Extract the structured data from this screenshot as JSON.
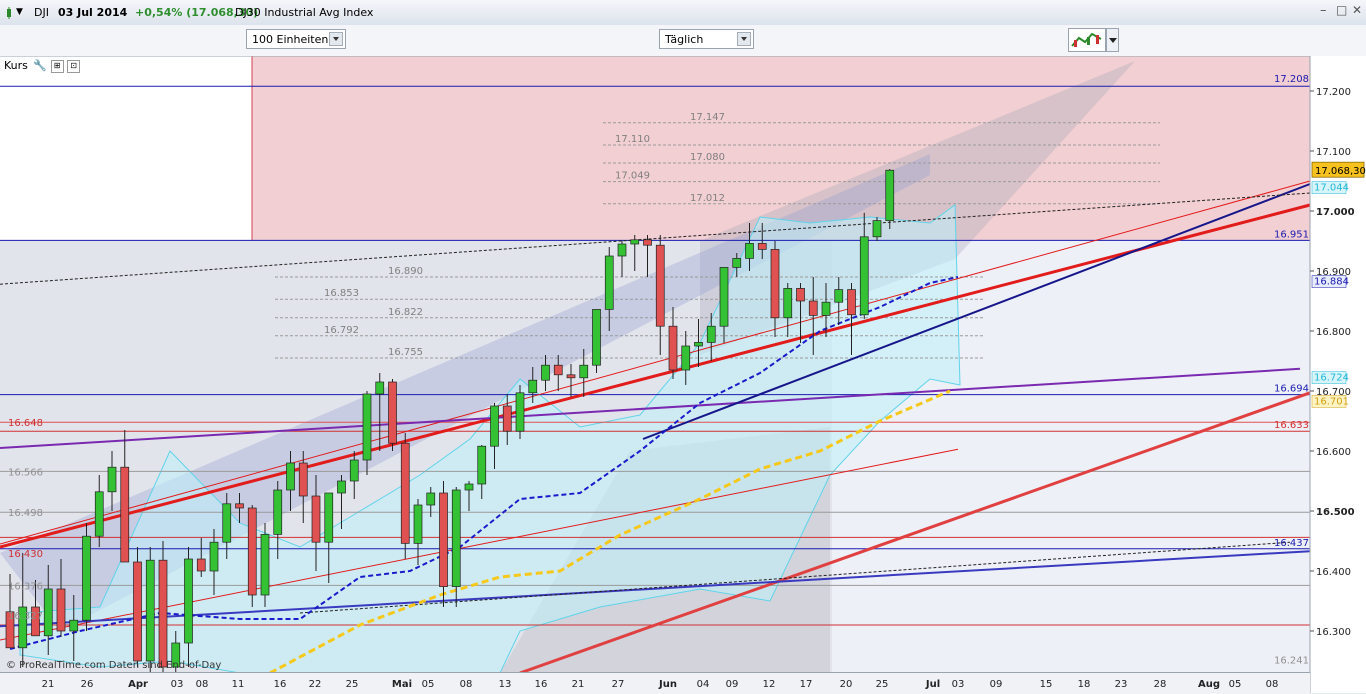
{
  "header": {
    "symbol": "DJI",
    "date": "03 Jul 2014",
    "change": "+0,54% (17.068,30)",
    "name": "DJ30 Industrial Avg Index"
  },
  "toolbar": {
    "units_select": "100 Einheiten",
    "period_select": "Täglich"
  },
  "panel": {
    "label": "Kurs"
  },
  "footer": {
    "copyright": "© ProRealTime.com Daten sind End-of-Day"
  },
  "chart_data": {
    "type": "candlestick",
    "ylim": [
      16230,
      17320
    ],
    "y_ticks": [
      "17.200",
      "17.100",
      "17.000",
      "16.900",
      "16.800",
      "16.700",
      "16.600",
      "16.500",
      "16.400",
      "16.300"
    ],
    "x_tick_labels": [
      "21",
      "26",
      "Apr",
      "03",
      "08",
      "11",
      "16",
      "22",
      "25",
      "Mai",
      "05",
      "08",
      "13",
      "16",
      "21",
      "27",
      "Jun",
      "04",
      "09",
      "12",
      "17",
      "20",
      "25",
      "Jul",
      "03",
      "09",
      "15",
      "18",
      "23",
      "28",
      "Aug",
      "05",
      "08"
    ],
    "last_price": "17.068,30",
    "right_labels": [
      "17.208",
      "17.044",
      "16.951",
      "16.884",
      "16.724",
      "16.694",
      "16.701",
      "16.633",
      "16.437",
      "16.241"
    ],
    "left_labels": [
      "16.648",
      "16.566",
      "16.498",
      "16.430",
      "16.376",
      "16.327"
    ],
    "fib_labels": [
      "17.147",
      "17.110",
      "17.080",
      "17.049",
      "17.012",
      "16.890",
      "16.853",
      "16.822",
      "16.792",
      "16.755"
    ],
    "candles": [
      {
        "o": 16332,
        "h": 16395,
        "l": 16290,
        "c": 16272
      },
      {
        "o": 16272,
        "h": 16430,
        "l": 16240,
        "c": 16340
      },
      {
        "o": 16340,
        "h": 16385,
        "l": 16300,
        "c": 16292
      },
      {
        "o": 16292,
        "h": 16410,
        "l": 16260,
        "c": 16370
      },
      {
        "o": 16370,
        "h": 16420,
        "l": 16290,
        "c": 16300
      },
      {
        "o": 16300,
        "h": 16360,
        "l": 16250,
        "c": 16318
      },
      {
        "o": 16318,
        "h": 16480,
        "l": 16300,
        "c": 16458
      },
      {
        "o": 16458,
        "h": 16560,
        "l": 16440,
        "c": 16532
      },
      {
        "o": 16532,
        "h": 16600,
        "l": 16500,
        "c": 16573
      },
      {
        "o": 16573,
        "h": 16635,
        "l": 16540,
        "c": 16415
      },
      {
        "o": 16415,
        "h": 16440,
        "l": 16240,
        "c": 16250
      },
      {
        "o": 16250,
        "h": 16440,
        "l": 16210,
        "c": 16418
      },
      {
        "o": 16418,
        "h": 16450,
        "l": 16220,
        "c": 16240
      },
      {
        "o": 16240,
        "h": 16300,
        "l": 16190,
        "c": 16280
      },
      {
        "o": 16280,
        "h": 16440,
        "l": 16240,
        "c": 16420
      },
      {
        "o": 16420,
        "h": 16455,
        "l": 16390,
        "c": 16400
      },
      {
        "o": 16400,
        "h": 16470,
        "l": 16360,
        "c": 16448
      },
      {
        "o": 16448,
        "h": 16530,
        "l": 16420,
        "c": 16512
      },
      {
        "o": 16512,
        "h": 16530,
        "l": 16480,
        "c": 16505
      },
      {
        "o": 16505,
        "h": 16510,
        "l": 16340,
        "c": 16360
      },
      {
        "o": 16360,
        "h": 16480,
        "l": 16340,
        "c": 16461
      },
      {
        "o": 16461,
        "h": 16550,
        "l": 16420,
        "c": 16535
      },
      {
        "o": 16535,
        "h": 16600,
        "l": 16500,
        "c": 16580
      },
      {
        "o": 16580,
        "h": 16600,
        "l": 16480,
        "c": 16525
      },
      {
        "o": 16525,
        "h": 16560,
        "l": 16400,
        "c": 16448
      },
      {
        "o": 16448,
        "h": 16530,
        "l": 16380,
        "c": 16530
      },
      {
        "o": 16530,
        "h": 16560,
        "l": 16470,
        "c": 16550
      },
      {
        "o": 16550,
        "h": 16600,
        "l": 16520,
        "c": 16585
      },
      {
        "o": 16585,
        "h": 16700,
        "l": 16560,
        "c": 16695
      },
      {
        "o": 16695,
        "h": 16730,
        "l": 16600,
        "c": 16715
      },
      {
        "o": 16715,
        "h": 16720,
        "l": 16600,
        "c": 16613
      },
      {
        "o": 16613,
        "h": 16630,
        "l": 16420,
        "c": 16446
      },
      {
        "o": 16446,
        "h": 16520,
        "l": 16410,
        "c": 16510
      },
      {
        "o": 16510,
        "h": 16540,
        "l": 16490,
        "c": 16530
      },
      {
        "o": 16530,
        "h": 16550,
        "l": 16340,
        "c": 16374
      },
      {
        "o": 16374,
        "h": 16540,
        "l": 16340,
        "c": 16535
      },
      {
        "o": 16535,
        "h": 16550,
        "l": 16500,
        "c": 16545
      },
      {
        "o": 16545,
        "h": 16610,
        "l": 16520,
        "c": 16608
      },
      {
        "o": 16608,
        "h": 16680,
        "l": 16570,
        "c": 16675
      },
      {
        "o": 16675,
        "h": 16695,
        "l": 16610,
        "c": 16633
      },
      {
        "o": 16633,
        "h": 16710,
        "l": 16620,
        "c": 16697
      },
      {
        "o": 16697,
        "h": 16740,
        "l": 16680,
        "c": 16718
      },
      {
        "o": 16718,
        "h": 16760,
        "l": 16700,
        "c": 16743
      },
      {
        "o": 16743,
        "h": 16760,
        "l": 16700,
        "c": 16727
      },
      {
        "o": 16727,
        "h": 16745,
        "l": 16690,
        "c": 16722
      },
      {
        "o": 16722,
        "h": 16770,
        "l": 16690,
        "c": 16743
      },
      {
        "o": 16743,
        "h": 16830,
        "l": 16730,
        "c": 16836
      },
      {
        "o": 16836,
        "h": 16940,
        "l": 16800,
        "c": 16925
      },
      {
        "o": 16925,
        "h": 16950,
        "l": 16890,
        "c": 16945
      },
      {
        "o": 16945,
        "h": 16960,
        "l": 16900,
        "c": 16952
      },
      {
        "o": 16952,
        "h": 16960,
        "l": 16890,
        "c": 16943
      },
      {
        "o": 16943,
        "h": 16960,
        "l": 16760,
        "c": 16808
      },
      {
        "o": 16808,
        "h": 16840,
        "l": 16720,
        "c": 16735
      },
      {
        "o": 16735,
        "h": 16800,
        "l": 16710,
        "c": 16775
      },
      {
        "o": 16775,
        "h": 16820,
        "l": 16740,
        "c": 16781
      },
      {
        "o": 16781,
        "h": 16830,
        "l": 16750,
        "c": 16808
      },
      {
        "o": 16808,
        "h": 16900,
        "l": 16780,
        "c": 16906
      },
      {
        "o": 16906,
        "h": 16930,
        "l": 16890,
        "c": 16921
      },
      {
        "o": 16921,
        "h": 16980,
        "l": 16900,
        "c": 16946
      },
      {
        "o": 16946,
        "h": 16980,
        "l": 16920,
        "c": 16936
      },
      {
        "o": 16936,
        "h": 16950,
        "l": 16790,
        "c": 16822
      },
      {
        "o": 16822,
        "h": 16880,
        "l": 16790,
        "c": 16871
      },
      {
        "o": 16871,
        "h": 16880,
        "l": 16780,
        "c": 16850
      },
      {
        "o": 16850,
        "h": 16890,
        "l": 16760,
        "c": 16826
      },
      {
        "o": 16826,
        "h": 16880,
        "l": 16790,
        "c": 16848
      },
      {
        "o": 16848,
        "h": 16890,
        "l": 16810,
        "c": 16869
      },
      {
        "o": 16869,
        "h": 16880,
        "l": 16760,
        "c": 16827
      },
      {
        "o": 16827,
        "h": 16997,
        "l": 16820,
        "c": 16957
      },
      {
        "o": 16957,
        "h": 16990,
        "l": 16950,
        "c": 16984
      },
      {
        "o": 16984,
        "h": 17070,
        "l": 16970,
        "c": 17068
      }
    ]
  }
}
